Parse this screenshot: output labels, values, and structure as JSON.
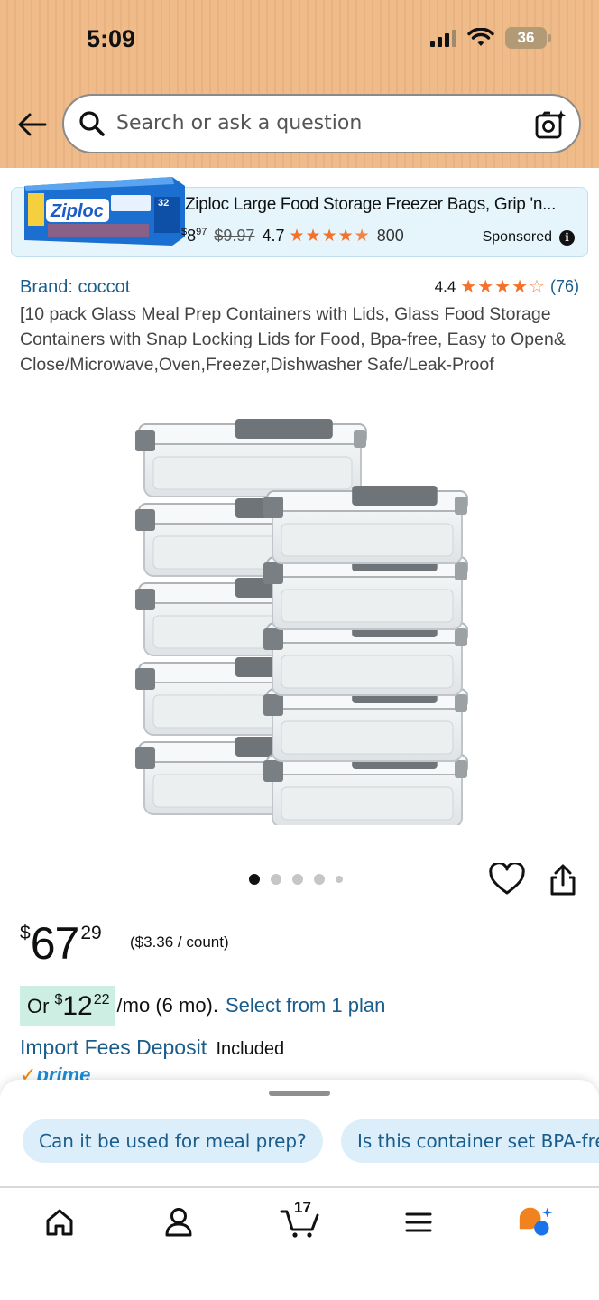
{
  "status_bar": {
    "time": "5:09",
    "battery": "36"
  },
  "search": {
    "placeholder": "Search or ask a question"
  },
  "ad": {
    "title": "Ziploc Large Food Storage Freezer Bags, Grip 'n...",
    "price_whole": "8",
    "price_fraction": "97",
    "price_currency": "$",
    "list_price": "$9.97",
    "rating": "4.7",
    "review_count": "800",
    "sponsored_label": "Sponsored",
    "image_brand": "Ziploc",
    "image_count": "32"
  },
  "product": {
    "brand": "Brand: coccot",
    "rating": "4.4",
    "review_count": "(76)",
    "title": "[10 pack Glass Meal Prep Containers with Lids, Glass Food Storage Containers with Snap Locking Lids for Food, Bpa-free, Easy to Open& Close/Microwave,Oven,Freezer,Dishwasher Safe/Leak-Proof",
    "image_index": 1,
    "image_total": 5
  },
  "price": {
    "currency": "$",
    "whole": "67",
    "fraction": "29",
    "unit_price": "($3.36 / count)"
  },
  "plan": {
    "prefix": "Or",
    "currency": "$",
    "whole": "12",
    "fraction": "22",
    "suffix": "/mo (6 mo).",
    "link": "Select from 1 plan"
  },
  "import_fees": {
    "label": "Import Fees Deposit",
    "value": "Included"
  },
  "prime_label": "prime",
  "suggestions": [
    "Can it be used for meal prep?",
    "Is this container set BPA-free?"
  ],
  "tabbar": {
    "cart_count": "17"
  },
  "colors": {
    "header": "#efbb88",
    "link": "#1a5c8b",
    "star": "#f4712a",
    "plan_highlight": "#cdefe3",
    "chip": "#dbeefa"
  }
}
